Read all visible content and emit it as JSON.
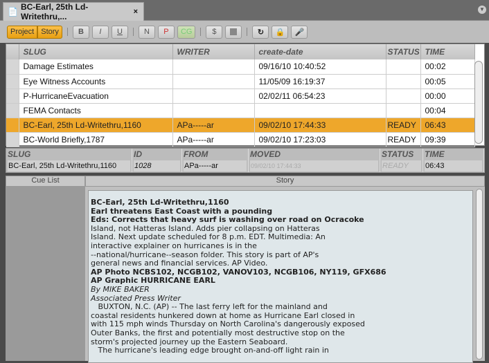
{
  "tab": {
    "title": "BC-Earl, 25th Ld-Writethru,...",
    "close": "×"
  },
  "toolbar": {
    "project": "Project",
    "story": "Story",
    "bold": "B",
    "italic": "I",
    "underline": "U",
    "n": "N",
    "p": "P",
    "cg": "CG"
  },
  "grid": {
    "columns": [
      "SLUG",
      "WRITER",
      "create-date",
      "STATUS",
      "TIME"
    ],
    "rows": [
      [
        "Damage Estimates",
        "",
        "09/16/10 10:40:52",
        "",
        "00:02"
      ],
      [
        "Eye Witness Accounts",
        "",
        "11/05/09 16:19:37",
        "",
        "00:05"
      ],
      [
        "P-HurricaneEvacuation",
        "",
        "02/02/11 06:54:23",
        "",
        "00:00"
      ],
      [
        "FEMA Contacts",
        "",
        "",
        "",
        "00:04"
      ],
      [
        "BC-Earl, 25th Ld-Writethru,1160",
        "APa-----ar",
        "09/02/10 17:44:33",
        "READY",
        "06:43"
      ],
      [
        "BC-World Briefly,1787",
        "APa-----ar",
        "09/02/10 17:23:03",
        "READY",
        "09:39"
      ]
    ]
  },
  "info": {
    "slug_label": "SLUG",
    "slug": "BC-Earl, 25th Ld-Writethru,1160",
    "id_label": "ID",
    "id": "1028",
    "from_label": "FROM",
    "from": "APa-----ar",
    "moved_label": "MOVED",
    "moved": "09/02/10 17:44:33",
    "status_label": "STATUS",
    "status": "READY",
    "time_label": "TIME",
    "time": "06:43"
  },
  "panes": {
    "cue_list": "Cue List",
    "story": "Story"
  },
  "story": [
    {
      "t": "BC-Earl, 25th Ld-Writethru,1160",
      "s": "b"
    },
    {
      "t": "Earl threatens East Coast with a pounding",
      "s": "b"
    },
    {
      "t": "Eds: Corrects that heavy surf is washing over road on Ocracoke",
      "s": "b"
    },
    {
      "t": "Island, not Hatteras Island. Adds pier collapsing on Hatteras",
      "s": ""
    },
    {
      "t": "Island. Next update scheduled for 8 p.m. EDT. Multimedia: An",
      "s": ""
    },
    {
      "t": "interactive explainer on hurricanes is in the",
      "s": ""
    },
    {
      "t": "--national/hurricane--season folder. This story is part of AP's",
      "s": ""
    },
    {
      "t": "general news and financial services. AP Video.",
      "s": ""
    },
    {
      "t": "AP Photo NCBS102, NCGB102, VANOV103, NCGB106, NY119, GFX686",
      "s": "b"
    },
    {
      "t": "AP Graphic HURRICANE EARL",
      "s": "b"
    },
    {
      "t": "By MIKE BAKER",
      "s": "i"
    },
    {
      "t": "Associated Press Writer",
      "s": "i"
    },
    {
      "t": "   BUXTON, N.C. (AP) -- The last ferry left for the mainland and",
      "s": ""
    },
    {
      "t": "coastal residents hunkered down at home as Hurricane Earl closed in",
      "s": ""
    },
    {
      "t": "with 115 mph winds Thursday on North Carolina's dangerously exposed",
      "s": ""
    },
    {
      "t": "Outer Banks, the first and potentially most destructive stop on the",
      "s": ""
    },
    {
      "t": "storm's projected journey up the Eastern Seaboard.",
      "s": ""
    },
    {
      "t": "   The hurricane's leading edge brought on-and-off light rain in",
      "s": ""
    }
  ]
}
